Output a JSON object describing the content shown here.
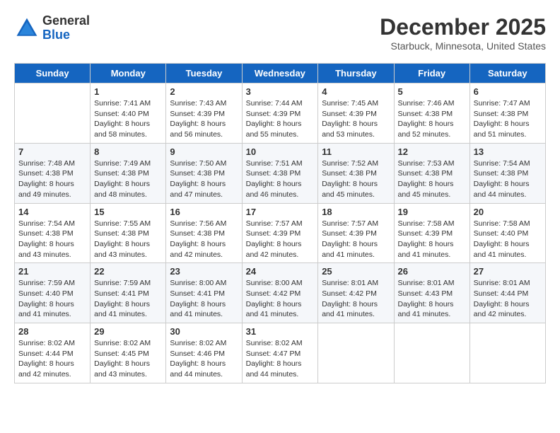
{
  "header": {
    "logo": {
      "line1": "General",
      "line2": "Blue"
    },
    "title": "December 2025",
    "subtitle": "Starbuck, Minnesota, United States"
  },
  "weekdays": [
    "Sunday",
    "Monday",
    "Tuesday",
    "Wednesday",
    "Thursday",
    "Friday",
    "Saturday"
  ],
  "weeks": [
    [
      {
        "day": "",
        "sunrise": "",
        "sunset": "",
        "daylight": ""
      },
      {
        "day": "1",
        "sunrise": "Sunrise: 7:41 AM",
        "sunset": "Sunset: 4:40 PM",
        "daylight": "Daylight: 8 hours and 58 minutes."
      },
      {
        "day": "2",
        "sunrise": "Sunrise: 7:43 AM",
        "sunset": "Sunset: 4:39 PM",
        "daylight": "Daylight: 8 hours and 56 minutes."
      },
      {
        "day": "3",
        "sunrise": "Sunrise: 7:44 AM",
        "sunset": "Sunset: 4:39 PM",
        "daylight": "Daylight: 8 hours and 55 minutes."
      },
      {
        "day": "4",
        "sunrise": "Sunrise: 7:45 AM",
        "sunset": "Sunset: 4:39 PM",
        "daylight": "Daylight: 8 hours and 53 minutes."
      },
      {
        "day": "5",
        "sunrise": "Sunrise: 7:46 AM",
        "sunset": "Sunset: 4:38 PM",
        "daylight": "Daylight: 8 hours and 52 minutes."
      },
      {
        "day": "6",
        "sunrise": "Sunrise: 7:47 AM",
        "sunset": "Sunset: 4:38 PM",
        "daylight": "Daylight: 8 hours and 51 minutes."
      }
    ],
    [
      {
        "day": "7",
        "sunrise": "Sunrise: 7:48 AM",
        "sunset": "Sunset: 4:38 PM",
        "daylight": "Daylight: 8 hours and 49 minutes."
      },
      {
        "day": "8",
        "sunrise": "Sunrise: 7:49 AM",
        "sunset": "Sunset: 4:38 PM",
        "daylight": "Daylight: 8 hours and 48 minutes."
      },
      {
        "day": "9",
        "sunrise": "Sunrise: 7:50 AM",
        "sunset": "Sunset: 4:38 PM",
        "daylight": "Daylight: 8 hours and 47 minutes."
      },
      {
        "day": "10",
        "sunrise": "Sunrise: 7:51 AM",
        "sunset": "Sunset: 4:38 PM",
        "daylight": "Daylight: 8 hours and 46 minutes."
      },
      {
        "day": "11",
        "sunrise": "Sunrise: 7:52 AM",
        "sunset": "Sunset: 4:38 PM",
        "daylight": "Daylight: 8 hours and 45 minutes."
      },
      {
        "day": "12",
        "sunrise": "Sunrise: 7:53 AM",
        "sunset": "Sunset: 4:38 PM",
        "daylight": "Daylight: 8 hours and 45 minutes."
      },
      {
        "day": "13",
        "sunrise": "Sunrise: 7:54 AM",
        "sunset": "Sunset: 4:38 PM",
        "daylight": "Daylight: 8 hours and 44 minutes."
      }
    ],
    [
      {
        "day": "14",
        "sunrise": "Sunrise: 7:54 AM",
        "sunset": "Sunset: 4:38 PM",
        "daylight": "Daylight: 8 hours and 43 minutes."
      },
      {
        "day": "15",
        "sunrise": "Sunrise: 7:55 AM",
        "sunset": "Sunset: 4:38 PM",
        "daylight": "Daylight: 8 hours and 43 minutes."
      },
      {
        "day": "16",
        "sunrise": "Sunrise: 7:56 AM",
        "sunset": "Sunset: 4:38 PM",
        "daylight": "Daylight: 8 hours and 42 minutes."
      },
      {
        "day": "17",
        "sunrise": "Sunrise: 7:57 AM",
        "sunset": "Sunset: 4:39 PM",
        "daylight": "Daylight: 8 hours and 42 minutes."
      },
      {
        "day": "18",
        "sunrise": "Sunrise: 7:57 AM",
        "sunset": "Sunset: 4:39 PM",
        "daylight": "Daylight: 8 hours and 41 minutes."
      },
      {
        "day": "19",
        "sunrise": "Sunrise: 7:58 AM",
        "sunset": "Sunset: 4:39 PM",
        "daylight": "Daylight: 8 hours and 41 minutes."
      },
      {
        "day": "20",
        "sunrise": "Sunrise: 7:58 AM",
        "sunset": "Sunset: 4:40 PM",
        "daylight": "Daylight: 8 hours and 41 minutes."
      }
    ],
    [
      {
        "day": "21",
        "sunrise": "Sunrise: 7:59 AM",
        "sunset": "Sunset: 4:40 PM",
        "daylight": "Daylight: 8 hours and 41 minutes."
      },
      {
        "day": "22",
        "sunrise": "Sunrise: 7:59 AM",
        "sunset": "Sunset: 4:41 PM",
        "daylight": "Daylight: 8 hours and 41 minutes."
      },
      {
        "day": "23",
        "sunrise": "Sunrise: 8:00 AM",
        "sunset": "Sunset: 4:41 PM",
        "daylight": "Daylight: 8 hours and 41 minutes."
      },
      {
        "day": "24",
        "sunrise": "Sunrise: 8:00 AM",
        "sunset": "Sunset: 4:42 PM",
        "daylight": "Daylight: 8 hours and 41 minutes."
      },
      {
        "day": "25",
        "sunrise": "Sunrise: 8:01 AM",
        "sunset": "Sunset: 4:42 PM",
        "daylight": "Daylight: 8 hours and 41 minutes."
      },
      {
        "day": "26",
        "sunrise": "Sunrise: 8:01 AM",
        "sunset": "Sunset: 4:43 PM",
        "daylight": "Daylight: 8 hours and 41 minutes."
      },
      {
        "day": "27",
        "sunrise": "Sunrise: 8:01 AM",
        "sunset": "Sunset: 4:44 PM",
        "daylight": "Daylight: 8 hours and 42 minutes."
      }
    ],
    [
      {
        "day": "28",
        "sunrise": "Sunrise: 8:02 AM",
        "sunset": "Sunset: 4:44 PM",
        "daylight": "Daylight: 8 hours and 42 minutes."
      },
      {
        "day": "29",
        "sunrise": "Sunrise: 8:02 AM",
        "sunset": "Sunset: 4:45 PM",
        "daylight": "Daylight: 8 hours and 43 minutes."
      },
      {
        "day": "30",
        "sunrise": "Sunrise: 8:02 AM",
        "sunset": "Sunset: 4:46 PM",
        "daylight": "Daylight: 8 hours and 44 minutes."
      },
      {
        "day": "31",
        "sunrise": "Sunrise: 8:02 AM",
        "sunset": "Sunset: 4:47 PM",
        "daylight": "Daylight: 8 hours and 44 minutes."
      },
      {
        "day": "",
        "sunrise": "",
        "sunset": "",
        "daylight": ""
      },
      {
        "day": "",
        "sunrise": "",
        "sunset": "",
        "daylight": ""
      },
      {
        "day": "",
        "sunrise": "",
        "sunset": "",
        "daylight": ""
      }
    ]
  ]
}
